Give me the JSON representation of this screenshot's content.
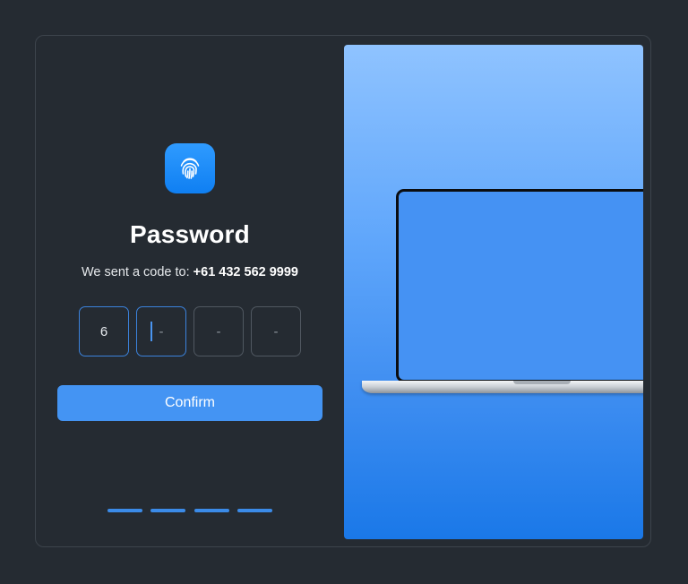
{
  "login": {
    "title": "Password",
    "subtitle_prefix": "We sent a code to:",
    "phone": "+61 432 562 9999",
    "otp": [
      {
        "value": "6",
        "state": "filled"
      },
      {
        "value": "-",
        "state": "active"
      },
      {
        "value": "-",
        "state": "empty"
      },
      {
        "value": "-",
        "state": "empty"
      }
    ],
    "confirm_label": "Confirm",
    "pagination": {
      "count": 4
    }
  },
  "icons": {
    "app_icon": "fingerprint-icon"
  },
  "colors": {
    "background": "#252b32",
    "accent": "#4494f3",
    "icon_gradient_top": "#2f9bff",
    "panel_gradient_top": "#8fc3ff",
    "panel_gradient_bottom": "#1a78e8"
  }
}
